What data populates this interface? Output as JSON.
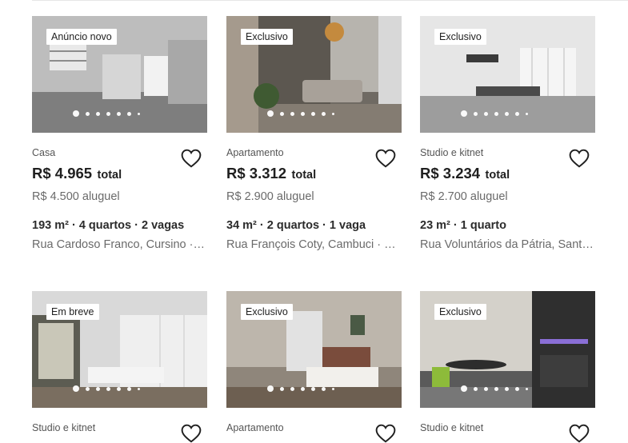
{
  "listings": [
    {
      "tag": "Anúncio novo",
      "type": "Casa",
      "price": "R$ 4.965",
      "price_label": "total",
      "rent": "R$ 4.500 aluguel",
      "features": "193 m² · 4 quartos · 2 vagas",
      "address": "Rua Cardoso Franco, Cursino · São Paulo"
    },
    {
      "tag": "Exclusivo",
      "type": "Apartamento",
      "price": "R$ 3.312",
      "price_label": "total",
      "rent": "R$ 2.900 aluguel",
      "features": "34 m² · 2 quartos · 1 vaga",
      "address": "Rua François Coty, Cambuci · São Paulo"
    },
    {
      "tag": "Exclusivo",
      "type": "Studio e kitnet",
      "price": "R$ 3.234",
      "price_label": "total",
      "rent": "R$ 2.700 aluguel",
      "features": "23 m² · 1 quarto",
      "address": "Rua Voluntários da Pátria, Santana"
    },
    {
      "tag": "Em breve",
      "type": "Studio e kitnet"
    },
    {
      "tag": "Exclusivo",
      "type": "Apartamento"
    },
    {
      "tag": "Exclusivo",
      "type": "Studio e kitnet"
    }
  ],
  "colors": {
    "heart": "#1f1f1f",
    "price": "#1f1f1f",
    "muted": "#6a6a6a"
  },
  "icons": {
    "favorite": "heart-outline-icon",
    "carousel": "carousel-dot"
  }
}
